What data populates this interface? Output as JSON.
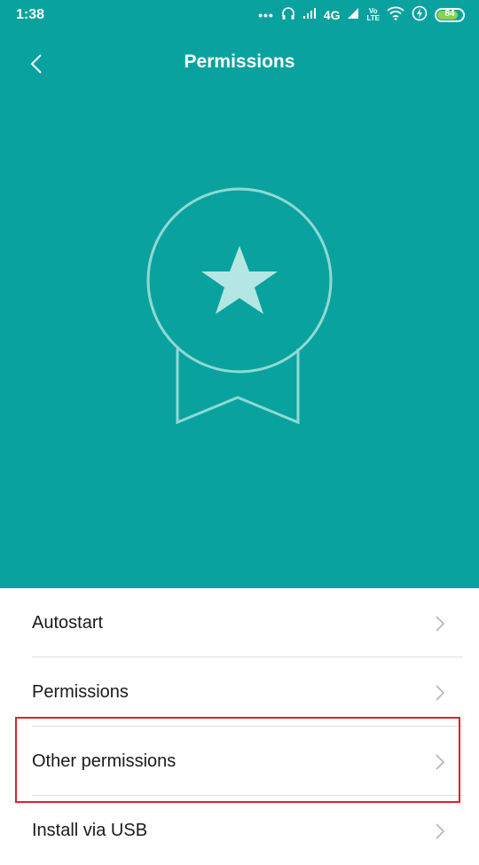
{
  "status_bar": {
    "time": "1:38",
    "dots": "•••",
    "network": "4G",
    "volte_top": "Vo",
    "volte_bottom": "LTE",
    "battery_percent": "84",
    "battery_level": 0.84
  },
  "header": {
    "title": "Permissions",
    "back_icon": "chevron-left-icon"
  },
  "hero": {
    "badge_icon": "star-badge-icon"
  },
  "list": {
    "items": [
      {
        "label": "Autostart"
      },
      {
        "label": "Permissions"
      },
      {
        "label": "Other permissions"
      },
      {
        "label": "Install via USB"
      }
    ]
  },
  "annotation": {
    "highlighted_item": "Other permissions",
    "color": "#d4262b"
  },
  "colors": {
    "accent": "#0aa29f",
    "text": "#1a1a1a",
    "divider": "#e2e2e2"
  }
}
